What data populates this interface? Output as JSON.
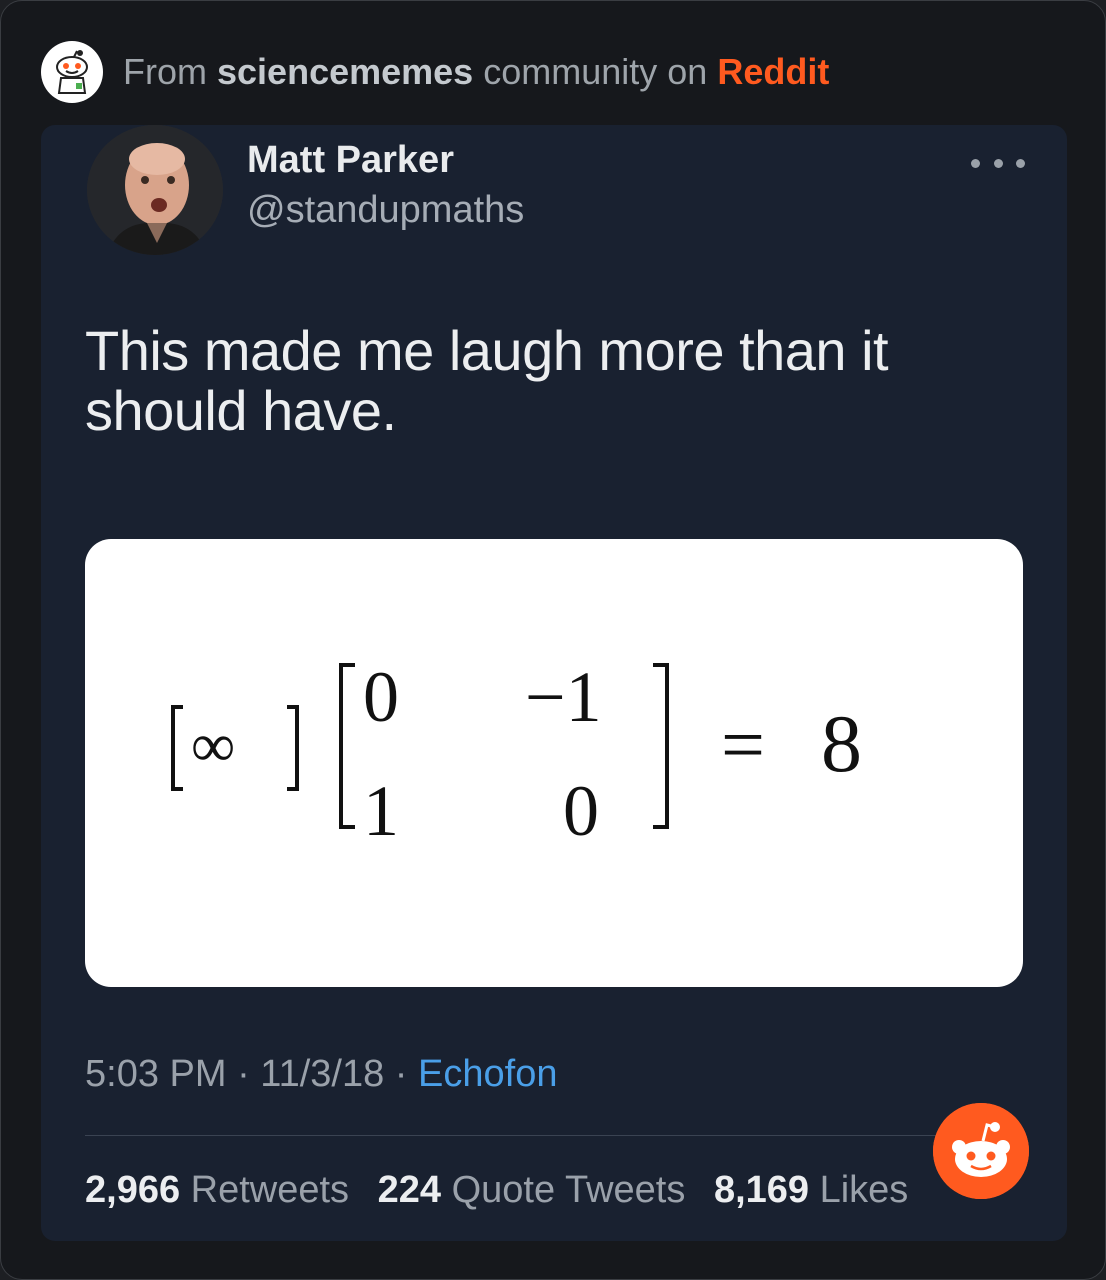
{
  "header": {
    "from_label": "From",
    "community": "sciencememes",
    "community_suffix": "community on",
    "platform": "Reddit"
  },
  "tweet": {
    "author_name": "Matt Parker",
    "author_handle": "@standupmaths",
    "text": "This made me laugh more than it should have.",
    "timestamp": "5:03 PM · 11/3/18 ·",
    "client": "Echofon",
    "retweets_count": "2,966",
    "retweets_label": "Retweets",
    "quotes_count": "224",
    "quotes_label": "Quote Tweets",
    "likes_count": "8,169",
    "likes_label": "Likes"
  },
  "media": {
    "row_vector": "∞",
    "matrix": [
      "0",
      "−1",
      "1",
      "0"
    ],
    "equals": "=",
    "result": "8"
  },
  "icons": {
    "badge": "reddit-snoo-icon",
    "more": "more-options-icon",
    "floating": "reddit-logo-icon"
  },
  "colors": {
    "reddit_orange": "#ff5a1f",
    "link_blue": "#4a9fe8",
    "card_bg": "#192130"
  }
}
